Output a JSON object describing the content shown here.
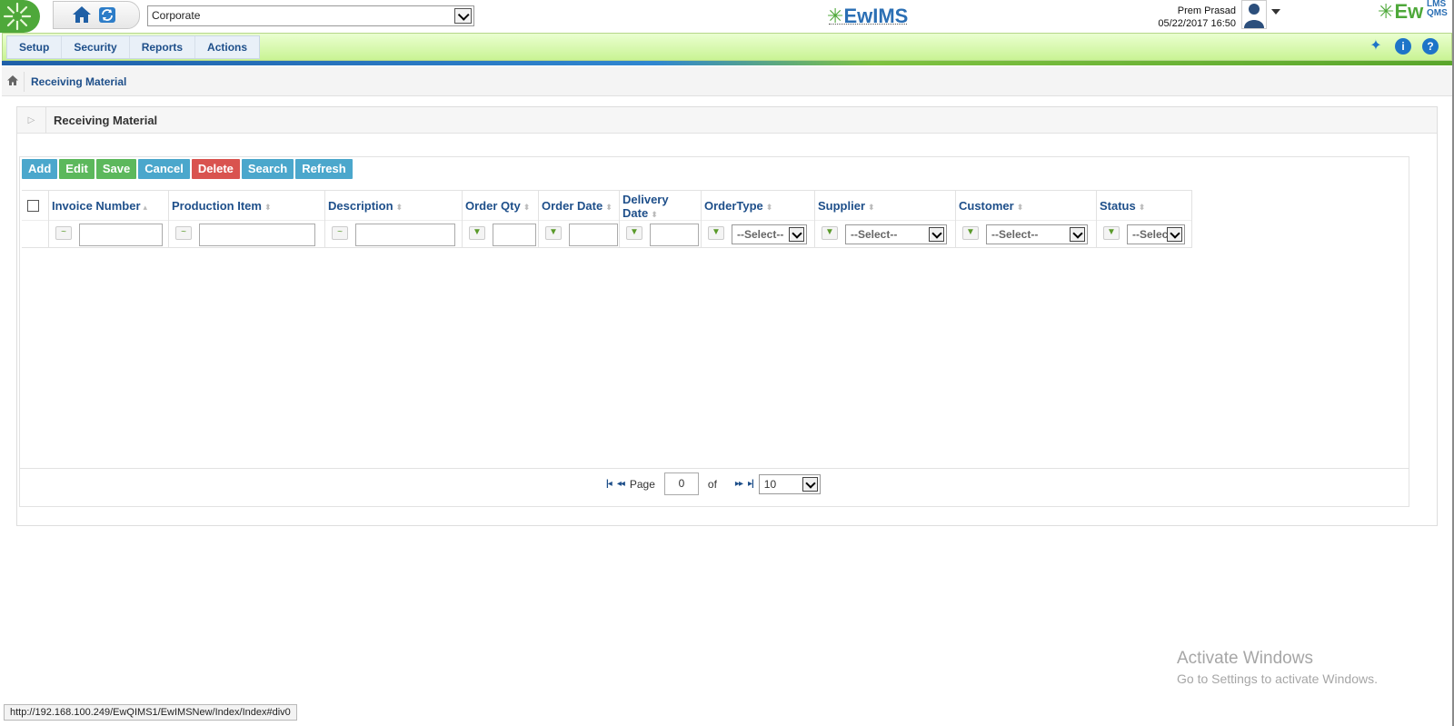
{
  "top": {
    "company_select": "Corporate",
    "center_logo": "EwIMS",
    "user_name": "Prem Prasad",
    "datetime": "05/22/2017 16:50",
    "right_logo": "Ew",
    "right_logo_small": "LMS QMS"
  },
  "menu": {
    "items": [
      "Setup",
      "Security",
      "Reports",
      "Actions"
    ],
    "icons": [
      "pin-icon",
      "info-icon",
      "help-icon"
    ]
  },
  "breadcrumb": {
    "current": "Receiving Material"
  },
  "panel": {
    "title": "Receiving Material"
  },
  "toolbar": {
    "add": "Add",
    "edit": "Edit",
    "save": "Save",
    "cancel": "Cancel",
    "delete": "Delete",
    "search": "Search",
    "refresh": "Refresh"
  },
  "columns": [
    {
      "label": "Invoice Number"
    },
    {
      "label": "Production Item"
    },
    {
      "label": "Description"
    },
    {
      "label": "Order Qty"
    },
    {
      "label": "Order Date"
    },
    {
      "label": "Delivery Date"
    },
    {
      "label": "OrderType"
    },
    {
      "label": "Supplier"
    },
    {
      "label": "Customer"
    },
    {
      "label": "Status"
    }
  ],
  "filters": {
    "ordertype": "--Select--",
    "supplier": "--Select--",
    "customer": "--Select--",
    "status": "--Select--"
  },
  "pager": {
    "page_label": "Page",
    "page_value": "0",
    "of_label": "of",
    "page_size": "10"
  },
  "overlay": {
    "activate_title": "Activate Windows",
    "activate_sub": "Go to Settings to activate Windows."
  },
  "status_url": "http://192.168.100.249/EwQIMS1/EwIMSNew/Index/Index#div0",
  "colors": {
    "accent_blue": "#1e4f8a",
    "brand_green": "#4ea83a",
    "btn_blue": "#4ba7cc",
    "btn_green": "#5cb85c",
    "btn_red": "#d9534f"
  }
}
